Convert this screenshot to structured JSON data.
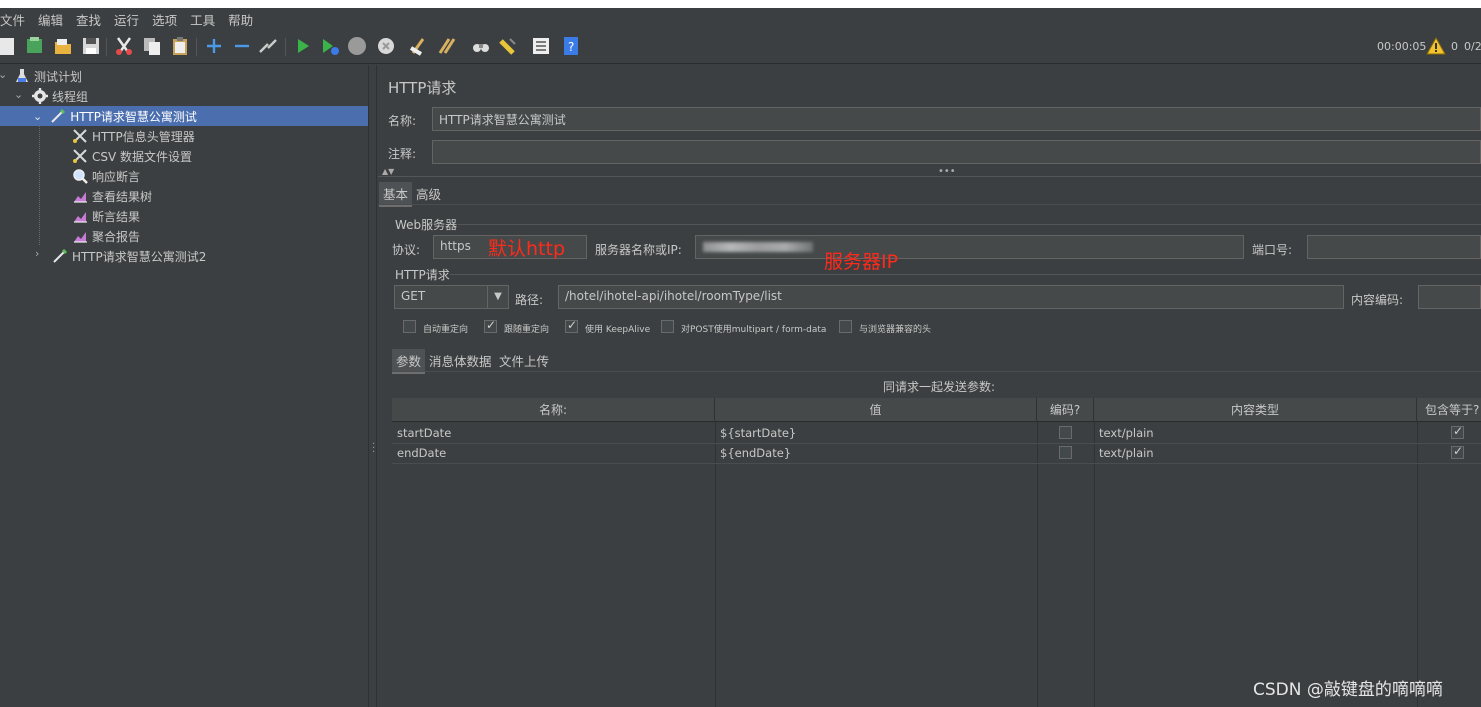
{
  "menu": [
    "文件",
    "编辑",
    "查找",
    "运行",
    "选项",
    "工具",
    "帮助"
  ],
  "toolbar": {
    "timer": "00:00:05",
    "warn_count": "0",
    "thread_ratio": "0/2"
  },
  "tree": {
    "items": [
      {
        "label": "测试计划",
        "icon": "test-plan-icon"
      },
      {
        "label": "线程组",
        "icon": "gear-icon"
      },
      {
        "label": "HTTP请求智慧公寓测试",
        "icon": "pipette-icon"
      },
      {
        "label": "HTTP信息头管理器",
        "icon": "scissors-icon"
      },
      {
        "label": "CSV 数据文件设置",
        "icon": "scissors-icon"
      },
      {
        "label": "响应断言",
        "icon": "magnifier-icon"
      },
      {
        "label": "查看结果树",
        "icon": "graph-icon"
      },
      {
        "label": "断言结果",
        "icon": "graph-icon"
      },
      {
        "label": "聚合报告",
        "icon": "graph-icon"
      },
      {
        "label": "HTTP请求智慧公寓测试2",
        "icon": "pipette-icon"
      }
    ]
  },
  "panel": {
    "title": "HTTP请求",
    "name_label": "名称:",
    "name_value": "HTTP请求智慧公寓测试",
    "comment_label": "注释:",
    "comment_value": "",
    "tabs": [
      "基本",
      "高级"
    ],
    "web_server_group": "Web服务器",
    "protocol_label": "协议:",
    "protocol_value": "https",
    "server_label": "服务器名称或IP:",
    "port_label": "端口号:",
    "http_group": "HTTP请求",
    "method_value": "GET",
    "path_label": "路径:",
    "path_value": "/hotel/ihotel-api/ihotel/roomType/list",
    "encoding_label": "内容编码:",
    "options": [
      {
        "label": "自动重定向",
        "checked": false
      },
      {
        "label": "跟随重定向",
        "checked": true
      },
      {
        "label": "使用 KeepAlive",
        "checked": true
      },
      {
        "label": "对POST使用multipart / form-data",
        "checked": false
      },
      {
        "label": "与浏览器兼容的头",
        "checked": false
      }
    ],
    "sub_tabs": [
      "参数",
      "消息体数据",
      "文件上传"
    ],
    "params_caption": "同请求一起发送参数:",
    "columns": [
      "名称:",
      "值",
      "编码?",
      "内容类型",
      "包含等于?"
    ],
    "rows": [
      {
        "name": "startDate",
        "value": "${startDate}",
        "encode": false,
        "content_type": "text/plain",
        "include_equals": true
      },
      {
        "name": "endDate",
        "value": "${endDate}",
        "encode": false,
        "content_type": "text/plain",
        "include_equals": true
      }
    ]
  },
  "annotations": {
    "protocol_note": "默认http",
    "server_note": "服务器IP"
  },
  "watermark": "CSDN @敲键盘的嘀嘀嘀",
  "colors": {
    "background": "#3c3f41",
    "selection": "#4b6eaf",
    "annotation_red": "#ff2a1a"
  }
}
